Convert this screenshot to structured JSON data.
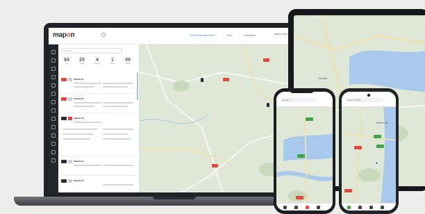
{
  "app": {
    "logo_text_a": "map",
    "logo_text_o": "o",
    "logo_text_b": "n"
  },
  "topbar": {
    "link": "Switch to previous version",
    "help": "Help",
    "notifications": "Notifications",
    "account": "Mapon Support"
  },
  "panel": {
    "search_placeholder": "All objects",
    "stats": [
      {
        "value": "84",
        "label": "All"
      },
      {
        "value": "20",
        "label": "Active"
      },
      {
        "value": "4",
        "label": "Parking"
      },
      {
        "value": "1",
        "label": "Alerts"
      },
      {
        "value": "59",
        "label": "Offline"
      }
    ],
    "vehicles": [
      {
        "name": "Vehicle 01"
      },
      {
        "name": "Vehicle 02"
      },
      {
        "name": "Vehicle 03"
      },
      {
        "name": "Vehicle 04"
      },
      {
        "name": "Vehicle 05"
      },
      {
        "name": "Vehicle 06"
      }
    ]
  },
  "map": {
    "zoom_in": "+",
    "zoom_out": "−"
  },
  "tablet": {
    "city_label": "Toronto"
  },
  "phone1": {
    "search": "Search"
  },
  "phone2": {
    "search": "Search vehicle",
    "city_label": "New York"
  },
  "colors": {
    "accent": "#4a84c9",
    "alert": "#e14a3b",
    "ok": "#40a54a",
    "sidebar": "#23272c"
  }
}
